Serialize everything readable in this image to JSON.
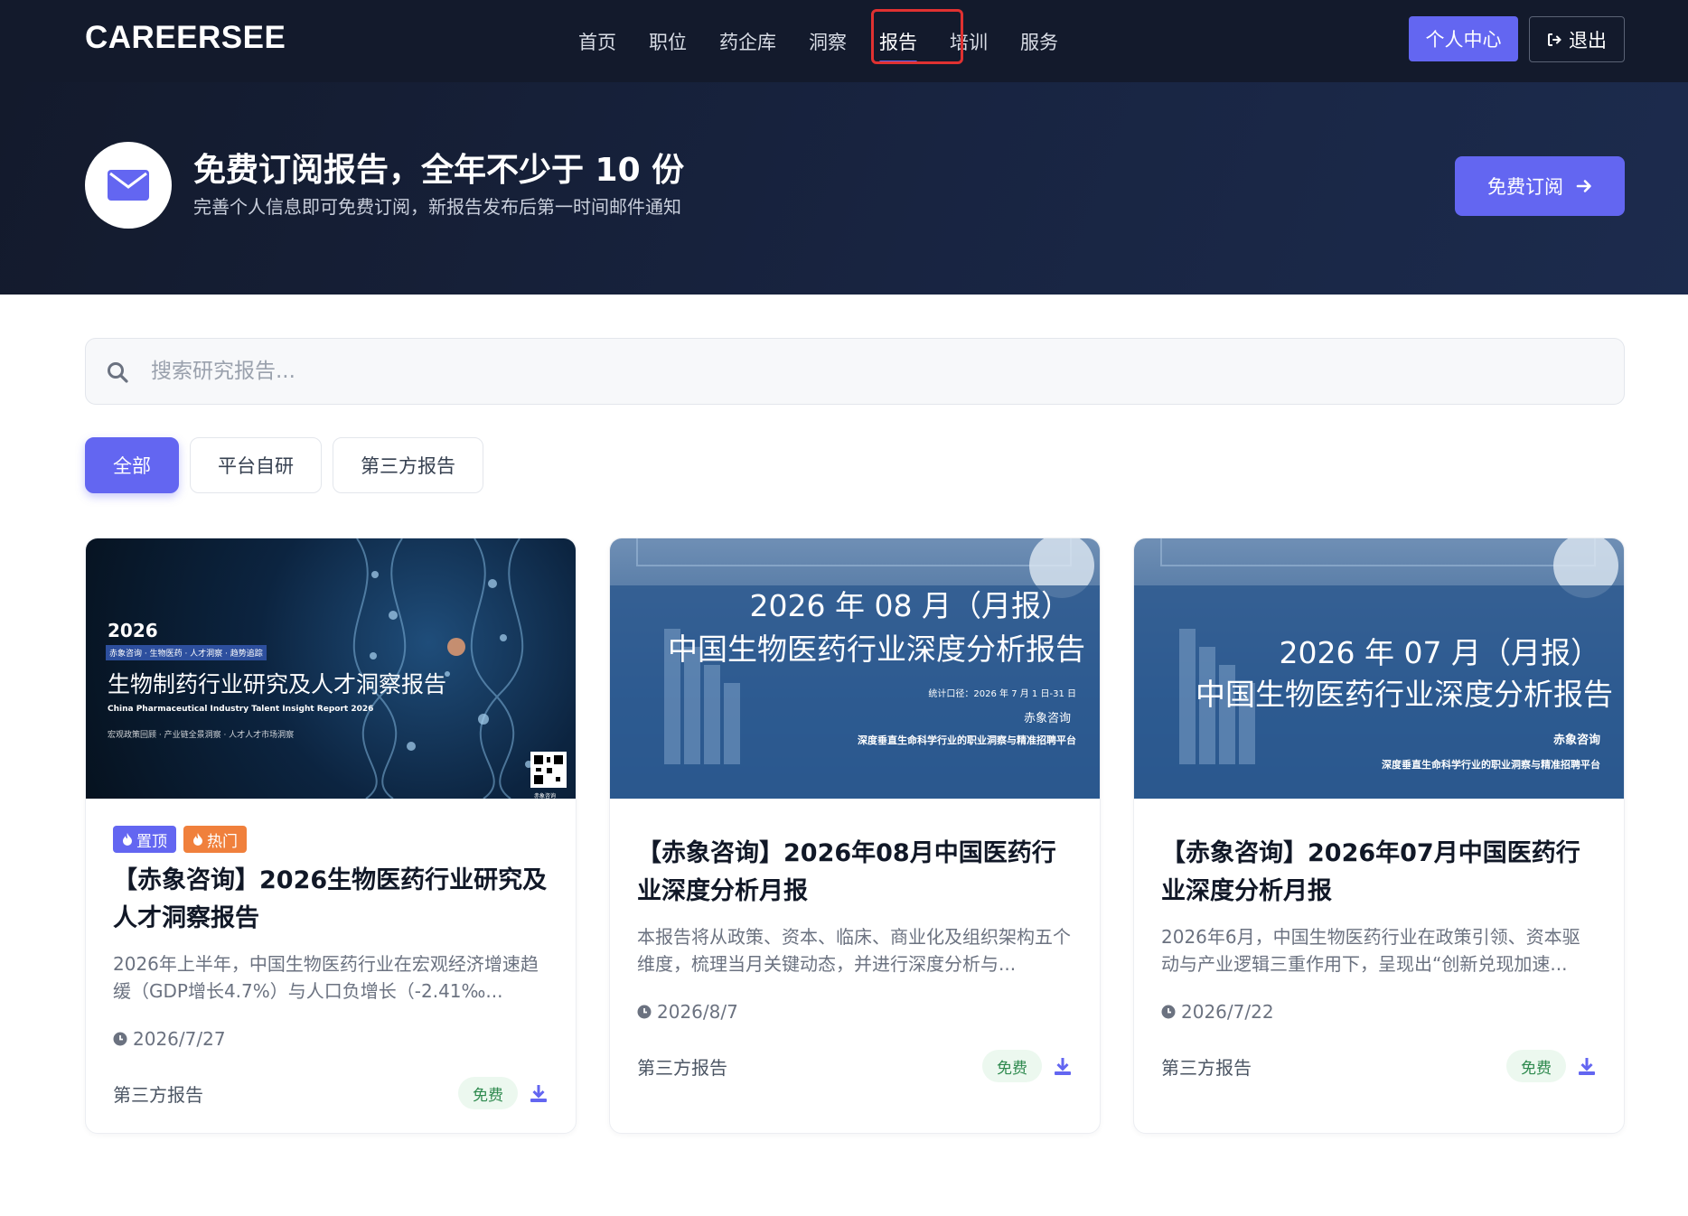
{
  "brand": {
    "logo": "CAREERSEE",
    "accent": "#6366f1",
    "dark_bg": "#131a2c"
  },
  "nav": {
    "items": [
      {
        "label": "首页"
      },
      {
        "label": "职位"
      },
      {
        "label": "药企库"
      },
      {
        "label": "洞察"
      },
      {
        "label": "报告",
        "active": true
      },
      {
        "label": "培训"
      },
      {
        "label": "服务"
      }
    ],
    "personal_center": "个人中心",
    "logout": "退出"
  },
  "banner": {
    "icon": "mail-icon",
    "title": "免费订阅报告，全年不少于 10 份",
    "subtitle": "完善个人信息即可免费订阅，新报告发布后第一时间邮件通知",
    "subscribe_button": "免费订阅"
  },
  "search": {
    "placeholder": "搜索研究报告..."
  },
  "filters": [
    {
      "label": "全部",
      "active": true
    },
    {
      "label": "平台自研"
    },
    {
      "label": "第三方报告"
    }
  ],
  "cards": [
    {
      "cover": {
        "year": "2026",
        "small_strip": "赤象咨询 · 生物医药 · 人才洞察 · 趋势追踪",
        "headline": "生物制药行业研究及人才洞察报告",
        "english": "China Pharmaceutical Industry Talent Insight Report 2026",
        "tagline": "宏观政策回顾 · 产业链全景洞察 · 人才人才市场洞察",
        "qr_caption": "赤象咨询"
      },
      "tags": [
        {
          "label": "置顶",
          "icon": "flame-icon"
        },
        {
          "label": "热门",
          "icon": "flame-icon"
        }
      ],
      "title": "【赤象咨询】2026生物医药行业研究及人才洞察报告",
      "desc": "2026年上半年，中国生物医药行业在宏观经济增速趋缓（GDP增长4.7%）与人口负增长（-2.41‰...",
      "date": "2026/7/27",
      "source": "第三方报告",
      "price": "免费"
    },
    {
      "cover": {
        "line1": "2026 年 08 月（月报）",
        "line2": "中国生物医药行业深度分析报告",
        "stat": "统计口径：2026 年 7 月 1 日-31 日",
        "org": "赤象咨询",
        "platform": "深度垂直生命科学行业的职业洞察与精准招聘平台"
      },
      "title": "【赤象咨询】2026年08月中国医药行业深度分析月报",
      "desc": "本报告将从政策、资本、临床、商业化及组织架构五个维度，梳理当月关键动态，并进行深度分析与...",
      "date": "2026/8/7",
      "source": "第三方报告",
      "price": "免费"
    },
    {
      "cover": {
        "line1": "2026 年 07 月（月报）",
        "line2": "中国生物医药行业深度分析报告",
        "org": "赤象咨询",
        "platform": "深度垂直生命科学行业的职业洞察与精准招聘平台"
      },
      "title": "【赤象咨询】2026年07月中国医药行业深度分析月报",
      "desc": "2026年6月，中国生物医药行业在政策引领、资本驱动与产业逻辑三重作用下，呈现出“创新兑现加速...",
      "date": "2026/7/22",
      "source": "第三方报告",
      "price": "免费"
    }
  ]
}
